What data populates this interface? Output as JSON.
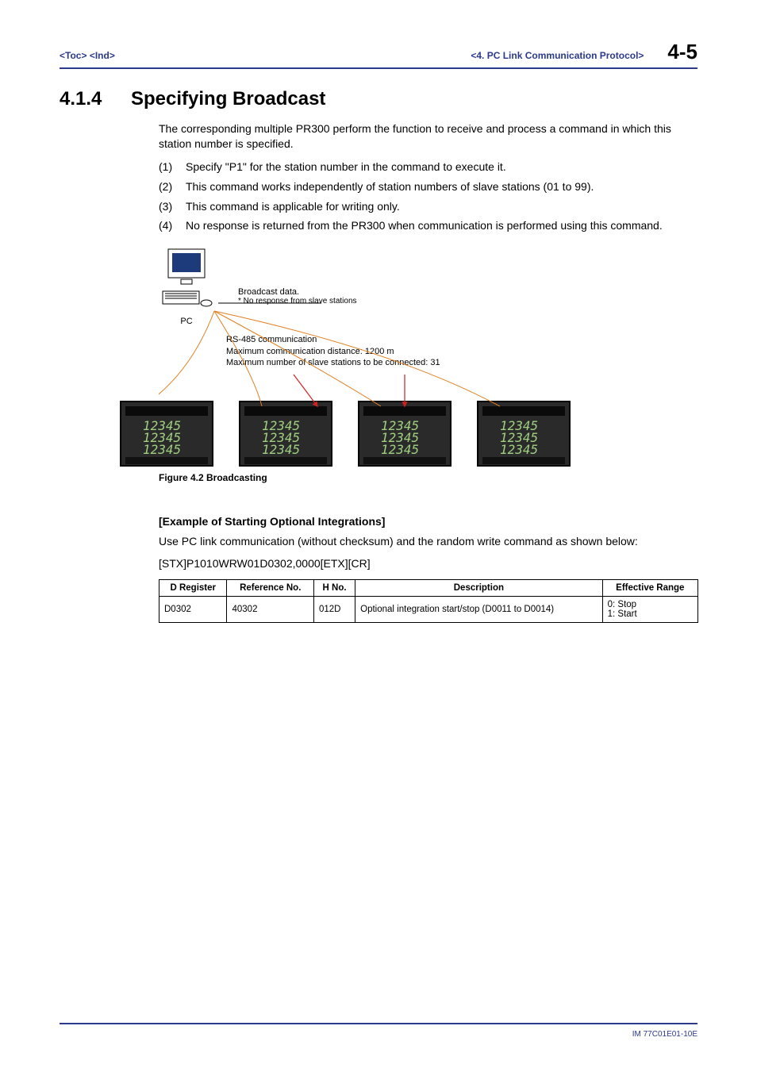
{
  "header": {
    "toc": "<Toc>",
    "ind": "<Ind>",
    "chapter": "<4.  PC Link Communication Protocol>",
    "page": "4-5"
  },
  "section": {
    "number": "4.1.4",
    "title": "Specifying Broadcast"
  },
  "intro": "The corresponding multiple PR300 perform the function to receive and process a command in which this station number is specified.",
  "list": [
    {
      "n": "(1)",
      "t": "Specify \"P1\" for the station number in the command to execute it."
    },
    {
      "n": "(2)",
      "t": "This command works independently of station numbers of slave stations (01 to 99)."
    },
    {
      "n": "(3)",
      "t": "This command is applicable for writing only."
    },
    {
      "n": "(4)",
      "t": "No response is returned from the PR300 when communication is performed using this command."
    }
  ],
  "figure": {
    "pc_label": "PC",
    "broadcast_title": "Broadcast data.",
    "broadcast_sub": "* No response from slave stations",
    "rs_line1": "RS-485 communication",
    "rs_line2": "Maximum communication distance: 1200 m",
    "rs_line3": "Maximum number of slave stations to be connected: 31",
    "caption": "Figure 4.2  Broadcasting"
  },
  "example": {
    "heading": "[Example of Starting Optional Integrations]",
    "text": "Use PC link communication (without checksum) and the random write command as shown below:",
    "code": "[STX]P1010WRW01D0302,0000[ETX][CR]"
  },
  "table": {
    "headers": [
      "D Register",
      "Reference No.",
      "H No.",
      "Description",
      "Effective Range"
    ],
    "row": {
      "dreg": "D0302",
      "ref": "40302",
      "hno": "012D",
      "desc": "Optional integration start/stop (D0011 to D0014)",
      "range": "0: Stop\n1: Start"
    }
  },
  "footer": "IM 77C01E01-10E"
}
